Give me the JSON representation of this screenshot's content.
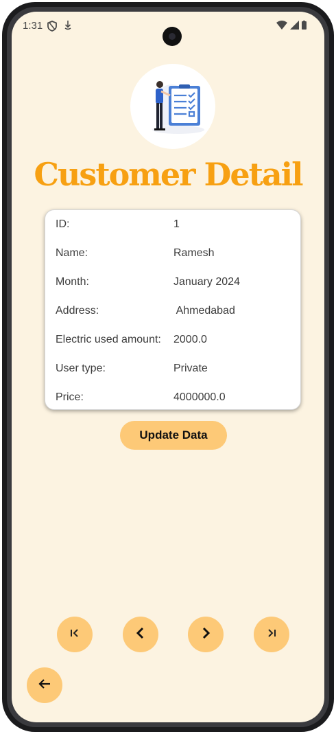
{
  "status_bar": {
    "time": "1:31"
  },
  "page": {
    "title": "Customer Detail"
  },
  "customer": {
    "rows": [
      {
        "label": "ID:",
        "value": "1"
      },
      {
        "label": "Name:",
        "value": "Ramesh"
      },
      {
        "label": "Month:",
        "value": "January 2024"
      },
      {
        "label": "Address:",
        "value": " Ahmedabad"
      },
      {
        "label": "Electric used amount:",
        "value": "2000.0"
      },
      {
        "label": "User type:",
        "value": "Private"
      },
      {
        "label": "Price:",
        "value": "4000000.0"
      }
    ]
  },
  "actions": {
    "update_label": "Update Data"
  },
  "navigation": {
    "first_icon": "skip-first-icon",
    "previous_icon": "chevron-left-icon",
    "next_icon": "chevron-right-icon",
    "last_icon": "skip-last-icon",
    "back_icon": "arrow-left-icon"
  },
  "colors": {
    "background": "#fcf3e1",
    "accent": "#f7a012",
    "button": "#fdc977"
  }
}
